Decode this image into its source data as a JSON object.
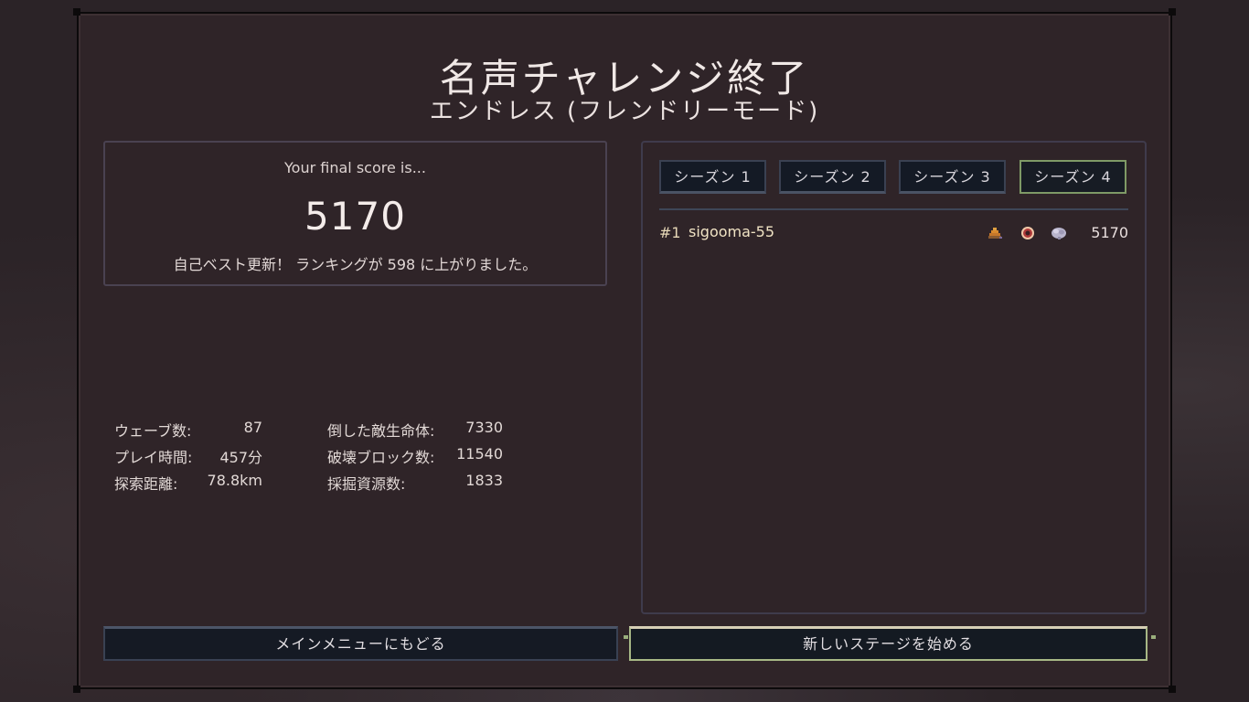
{
  "header": {
    "title": "名声チャレンジ終了",
    "subtitle": "エンドレス (フレンドリーモード)"
  },
  "score": {
    "label": "Your final score is...",
    "value": "5170",
    "note": "自己ベスト更新！ ランキングが 598 に上がりました。"
  },
  "stats": [
    {
      "label": "ウェーブ数:",
      "value": "87"
    },
    {
      "label": "プレイ時間:",
      "value": "457分"
    },
    {
      "label": "探索距離:",
      "value": "78.8km"
    },
    {
      "label": "倒した敵生命体:",
      "value": "7330"
    },
    {
      "label": "破壊ブロック数:",
      "value": "11540"
    },
    {
      "label": "採掘資源数:",
      "value": "1833"
    }
  ],
  "leaderboard": {
    "tabs": [
      {
        "label": "シーズン 1",
        "active": false
      },
      {
        "label": "シーズン 2",
        "active": false
      },
      {
        "label": "シーズン 3",
        "active": false
      },
      {
        "label": "シーズン 4",
        "active": true
      }
    ],
    "entries": [
      {
        "rank": "#1",
        "name": "sigooma-55",
        "score": "5170",
        "icons": [
          "drill-icon",
          "eye-orb-icon",
          "brain-icon"
        ]
      }
    ]
  },
  "buttons": {
    "main_menu": "メインメニューにもどる",
    "new_stage": "新しいステージを始める"
  },
  "colors": {
    "panel_bg": "#2f2428",
    "button_bg": "#151a24",
    "active_accent": "#7f9a66",
    "name_color": "#f0e3c4"
  }
}
